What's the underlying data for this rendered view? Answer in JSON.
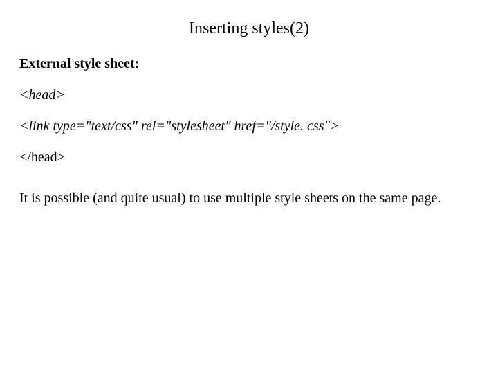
{
  "title": "Inserting styles(2)",
  "subheading": "External style sheet:",
  "code": {
    "line1": "<head>",
    "line2": "<link type=\"text/css\" rel=\"stylesheet\" href=\"/style. css\">",
    "line3": "</head>"
  },
  "paragraph": "It is possible (and quite usual) to use multiple style sheets on the same page."
}
